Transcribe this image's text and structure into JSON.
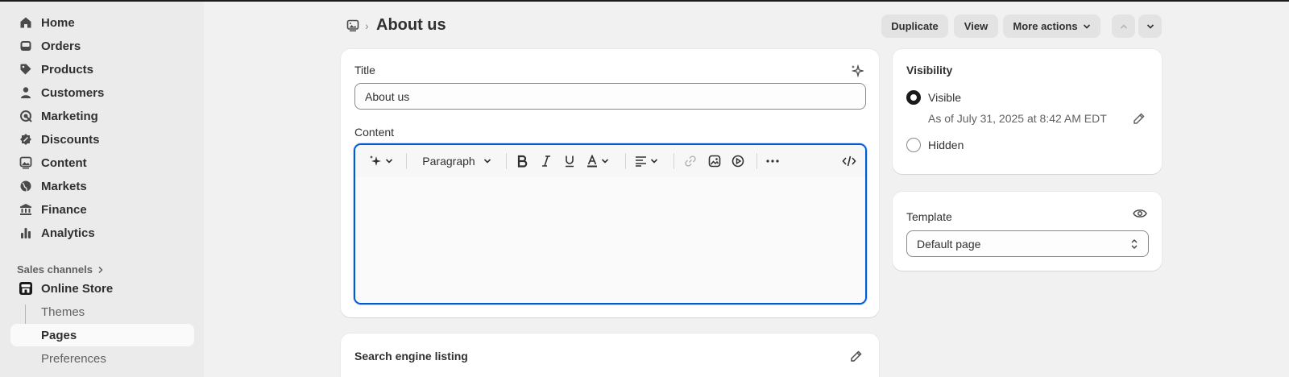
{
  "sidebar": {
    "items": [
      {
        "label": "Home",
        "icon": "home-icon"
      },
      {
        "label": "Orders",
        "icon": "inbox-icon"
      },
      {
        "label": "Products",
        "icon": "tag-icon"
      },
      {
        "label": "Customers",
        "icon": "person-icon"
      },
      {
        "label": "Marketing",
        "icon": "target-icon"
      },
      {
        "label": "Discounts",
        "icon": "discount-icon"
      },
      {
        "label": "Content",
        "icon": "image-icon"
      },
      {
        "label": "Markets",
        "icon": "globe-icon"
      },
      {
        "label": "Finance",
        "icon": "bank-icon"
      },
      {
        "label": "Analytics",
        "icon": "bar-chart-icon"
      }
    ],
    "sales_channels_label": "Sales channels",
    "online_store": {
      "label": "Online Store",
      "icon": "store-icon"
    },
    "sub_items": [
      {
        "label": "Themes"
      },
      {
        "label": "Pages",
        "active": true
      },
      {
        "label": "Preferences"
      }
    ]
  },
  "header": {
    "title": "About us",
    "duplicate_label": "Duplicate",
    "view_label": "View",
    "more_actions_label": "More actions"
  },
  "main": {
    "title_label": "Title",
    "title_value": "About us",
    "content_label": "Content",
    "toolbar": {
      "paragraph_label": "Paragraph"
    },
    "seo_heading": "Search engine listing"
  },
  "visibility": {
    "heading": "Visibility",
    "visible_label": "Visible",
    "visible_date": "As of July 31, 2025 at 8:42 AM EDT",
    "hidden_label": "Hidden",
    "selected": "Visible"
  },
  "template": {
    "label": "Template",
    "selected": "Default page"
  },
  "colors": {
    "accent_focus": "#005bd3",
    "sidebar_bg": "#ebebeb",
    "page_bg": "#f1f1f1"
  }
}
